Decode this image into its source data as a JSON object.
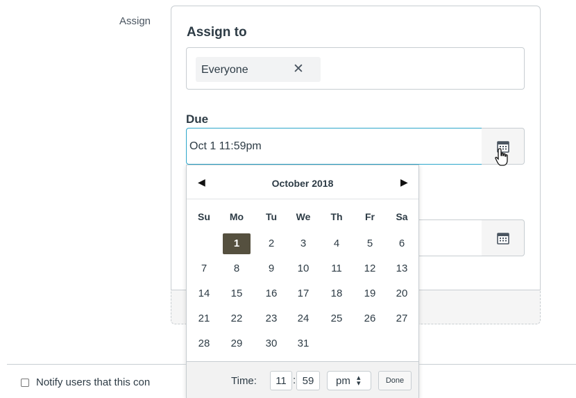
{
  "assign_label": "Assign",
  "card": {
    "heading": "Assign to",
    "assignee_token": "Everyone",
    "token_remove_icon": "close-icon",
    "due_label": "Due",
    "due_value": "Oct 1 11:59pm",
    "calendar_icon": "calendar-icon"
  },
  "datepicker": {
    "month_title": "October 2018",
    "prev_icon": "triangle-left-icon",
    "next_icon": "triangle-right-icon",
    "weekdays": [
      "Su",
      "Mo",
      "Tu",
      "We",
      "Th",
      "Fr",
      "Sa"
    ],
    "weeks": [
      [
        "",
        "1",
        "2",
        "3",
        "4",
        "5",
        "6"
      ],
      [
        "7",
        "8",
        "9",
        "10",
        "11",
        "12",
        "13"
      ],
      [
        "14",
        "15",
        "16",
        "17",
        "18",
        "19",
        "20"
      ],
      [
        "21",
        "22",
        "23",
        "24",
        "25",
        "26",
        "27"
      ],
      [
        "28",
        "29",
        "30",
        "31",
        "",
        "",
        ""
      ]
    ],
    "selected_day": "1",
    "time_label": "Time:",
    "hour": "11",
    "minute": "59",
    "time_separator": ":",
    "ampm": "pm",
    "ampm_arrows": "▲▼",
    "done_label": "Done"
  },
  "notify_label": "Notify users that this con",
  "colors": {
    "focus_border": "#2ba6cb",
    "selected_day_bg": "#55503f",
    "text": "#2d3b45"
  }
}
